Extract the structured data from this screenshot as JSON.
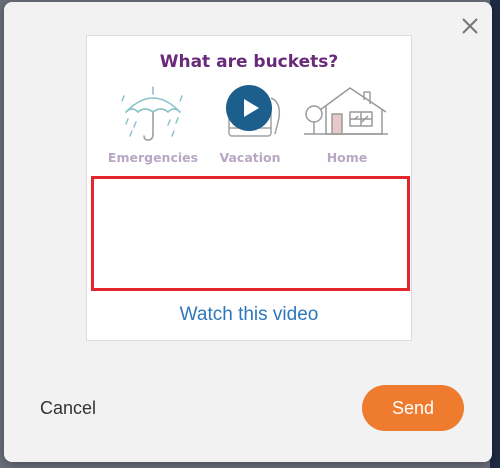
{
  "colors": {
    "title": "#6a2a7a",
    "label": "#b8a8c4",
    "link": "#2d77bd",
    "highlight_border": "#e2262b",
    "send_button": "#ee7b2e",
    "play_button": "#1d5f8c"
  },
  "dialog": {
    "close_icon": "close-icon",
    "card": {
      "title": "What are buckets?",
      "buckets": [
        {
          "label": "Emergencies",
          "icon": "umbrella-rain-icon"
        },
        {
          "label": "Vacation",
          "icon": "luggage-icon"
        },
        {
          "label": "Home",
          "icon": "house-icon"
        }
      ],
      "play_icon": "play-icon",
      "link_text": "Watch this video"
    },
    "footer": {
      "cancel_label": "Cancel",
      "send_label": "Send"
    }
  }
}
